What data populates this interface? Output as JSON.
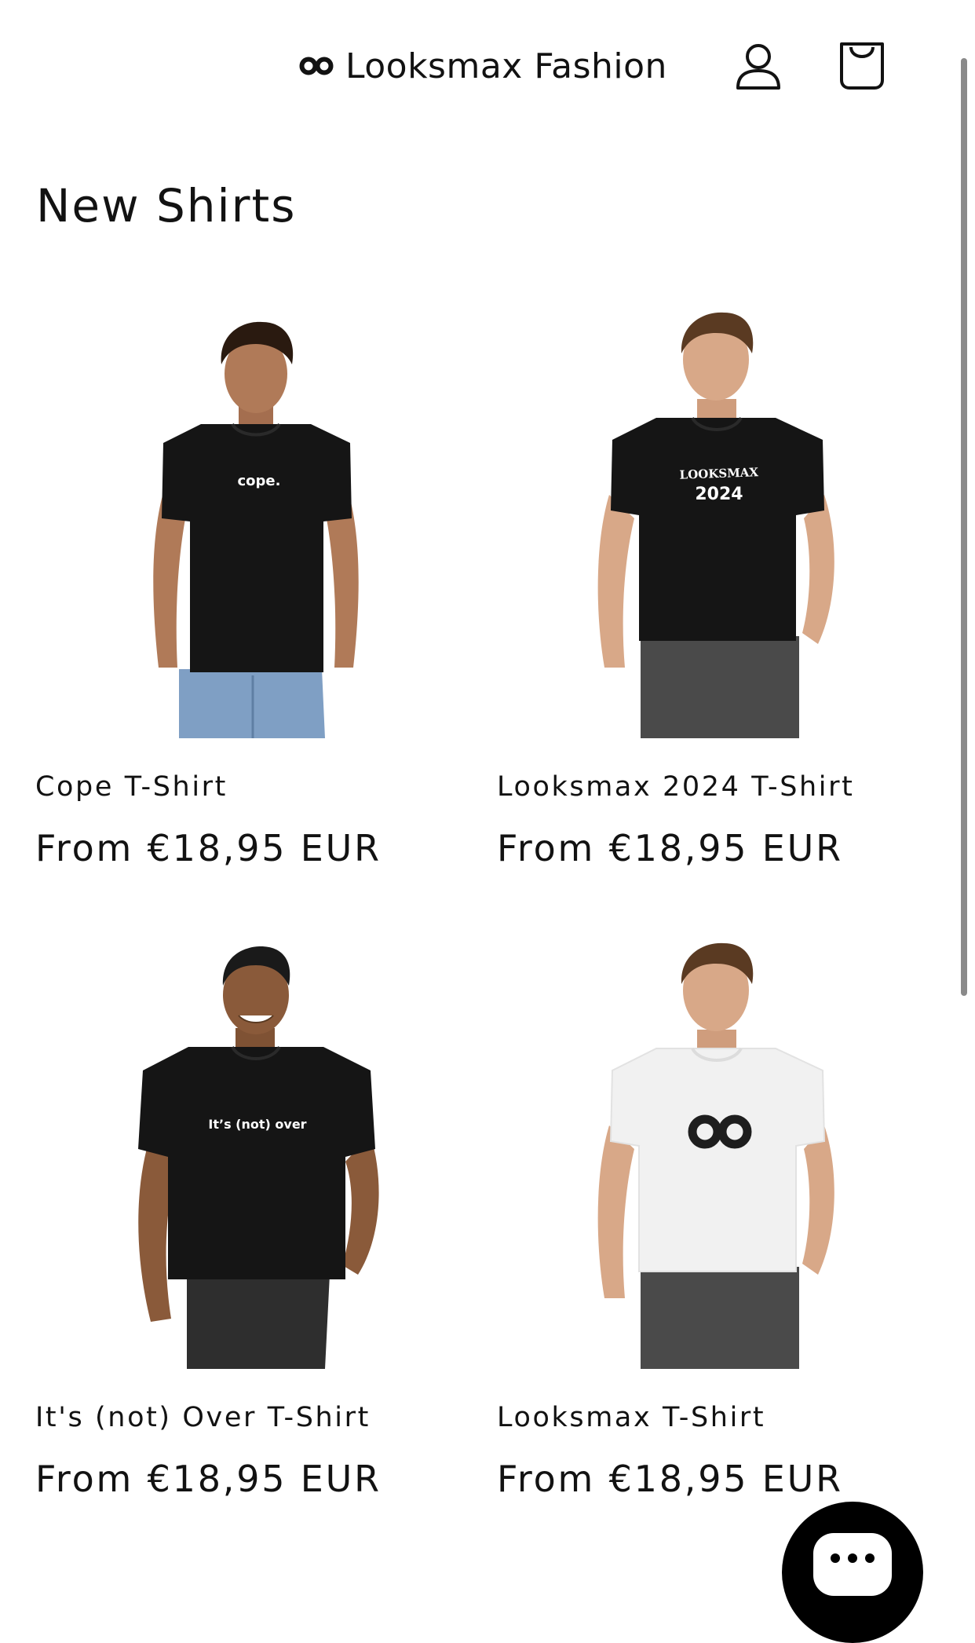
{
  "header": {
    "brand_name": "Looksmax Fashion",
    "brand_icon": "infinity-logo-icon",
    "account_icon": "account-icon",
    "cart_icon": "cart-icon"
  },
  "collection": {
    "title": "New Shirts"
  },
  "products": [
    {
      "name": "Cope T-Shirt",
      "price": "From €18,95 EUR",
      "shirt_print": "cope.",
      "shirt_color": "#151515",
      "pants_color": "#7f9fc4"
    },
    {
      "name": "Looksmax 2024 T-Shirt",
      "price": "From €18,95 EUR",
      "shirt_print_line1": "LOOKSMAX",
      "shirt_print_line2": "2024",
      "shirt_color": "#151515",
      "pants_color": "#4a4a4a"
    },
    {
      "name": "It's (not) Over T-Shirt",
      "price": "From €18,95 EUR",
      "shirt_print": "It’s (not) over",
      "shirt_color": "#151515",
      "pants_color": "#2e2e2e"
    },
    {
      "name": "Looksmax T-Shirt",
      "price": "From €18,95 EUR",
      "shirt_print_icon": "infinity-logo-icon",
      "shirt_color": "#f1f1f1",
      "pants_color": "#4a4a4a"
    }
  ],
  "chat": {
    "icon": "chat-icon"
  },
  "colors": {
    "text": "#121212",
    "background": "#ffffff",
    "chat_button": "#000000"
  }
}
